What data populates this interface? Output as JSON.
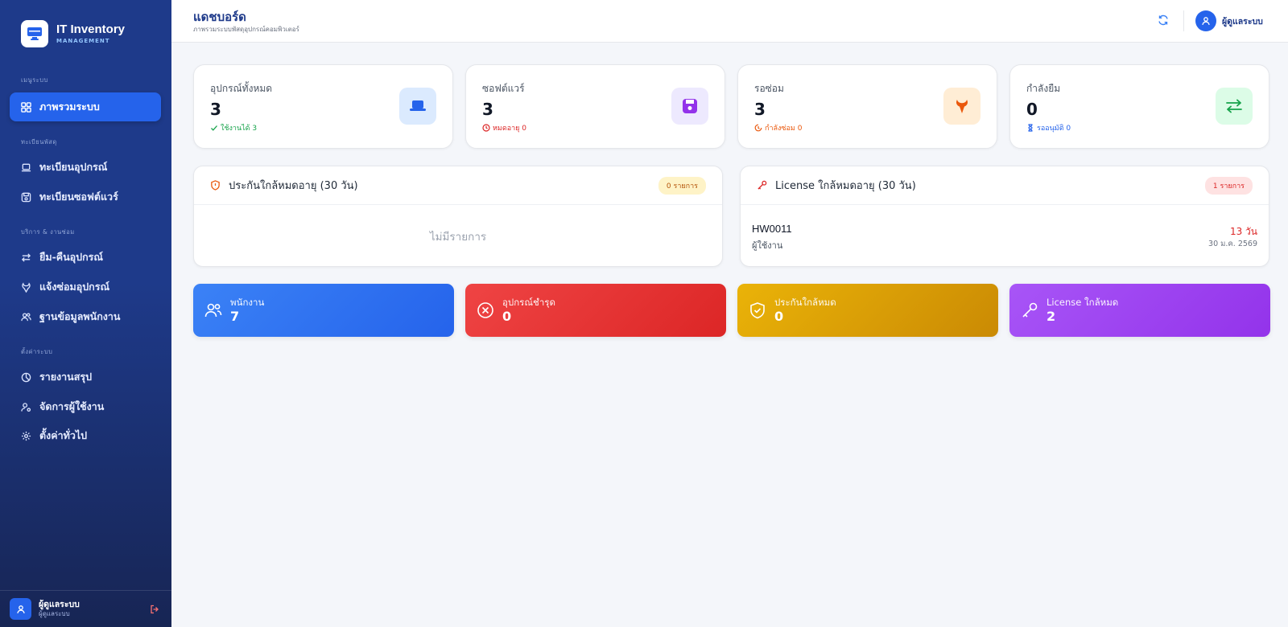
{
  "brand": {
    "title": "IT Inventory",
    "subtitle": "MANAGEMENT"
  },
  "sidebar": {
    "sections": [
      {
        "title": "เมนูระบบ"
      },
      {
        "title": "ทะเบียนพัสดุ"
      },
      {
        "title": "บริการ & งานซ่อม"
      },
      {
        "title": "ตั้งค่าระบบ"
      }
    ],
    "items": [
      {
        "label": "ภาพรวมระบบ",
        "icon": "grid-icon",
        "active": true
      },
      {
        "label": "ทะเบียนอุปกรณ์",
        "icon": "laptop-icon"
      },
      {
        "label": "ทะเบียนซอฟต์แวร์",
        "icon": "save-icon"
      },
      {
        "label": "ยืม-คืนอุปกรณ์",
        "icon": "exchange-icon"
      },
      {
        "label": "แจ้งซ่อมอุปกรณ์",
        "icon": "wrench-icon"
      },
      {
        "label": "ฐานข้อมูลพนักงาน",
        "icon": "users-icon"
      },
      {
        "label": "รายงานสรุป",
        "icon": "pie-chart-icon"
      },
      {
        "label": "จัดการผู้ใช้งาน",
        "icon": "user-cog-icon"
      },
      {
        "label": "ตั้งค่าทั่วไป",
        "icon": "gear-icon"
      }
    ],
    "footer": {
      "name": "ผู้ดูแลระบบ",
      "role": "ผู้ดูแลระบบ"
    }
  },
  "header": {
    "title": "แดชบอร์ด",
    "subtitle": "ภาพรวมระบบพัสดุอุปกรณ์คอมพิวเตอร์",
    "user": "ผู้ดูแลระบบ"
  },
  "stats": [
    {
      "label": "อุปกรณ์ทั้งหมด",
      "value": "3",
      "note": "ใช้งานได้ 3",
      "note_color": "#16a34a",
      "icon": "laptop-icon",
      "icon_bg": "#dbeafe",
      "icon_color": "#2563eb"
    },
    {
      "label": "ซอฟต์แวร์",
      "value": "3",
      "note": "หมดอายุ 0",
      "note_color": "#dc2626",
      "icon": "save-icon",
      "icon_bg": "#ede9fe",
      "icon_color": "#9333ea"
    },
    {
      "label": "รอซ่อม",
      "value": "3",
      "note": "กำลังซ่อม 0",
      "note_color": "#ea580c",
      "icon": "wrench-icon",
      "icon_bg": "#ffedd5",
      "icon_color": "#ea580c"
    },
    {
      "label": "กำลังยืม",
      "value": "0",
      "note": "รออนุมัติ 0",
      "note_color": "#2563eb",
      "icon": "exchange-icon",
      "icon_bg": "#dcfce7",
      "icon_color": "#16a34a"
    }
  ],
  "warranty_panel": {
    "title": "ประกันใกล้หมดอายุ (30 วัน)",
    "badge": "0 รายการ",
    "empty": "ไม่มีรายการ"
  },
  "license_panel": {
    "title": "License ใกล้หมดอายุ (30 วัน)",
    "badge": "1 รายการ",
    "rows": [
      {
        "code": "HW0011",
        "owner": "ผู้ใช้งาน",
        "days": "13 วัน",
        "date": "30 ม.ค. 2569"
      }
    ]
  },
  "summary": [
    {
      "label": "พนักงาน",
      "value": "7",
      "icon": "users-icon",
      "color_from": "#3b82f6",
      "color_to": "#2563eb"
    },
    {
      "label": "อุปกรณ์ชำรุด",
      "value": "0",
      "icon": "x-circle-icon",
      "color_from": "#ef4444",
      "color_to": "#dc2626"
    },
    {
      "label": "ประกันใกล้หมด",
      "value": "0",
      "icon": "shield-icon",
      "color_from": "#eab308",
      "color_to": "#ca8a04"
    },
    {
      "label": "License ใกล้หมด",
      "value": "2",
      "icon": "key-icon",
      "color_from": "#a855f7",
      "color_to": "#9333ea"
    }
  ]
}
